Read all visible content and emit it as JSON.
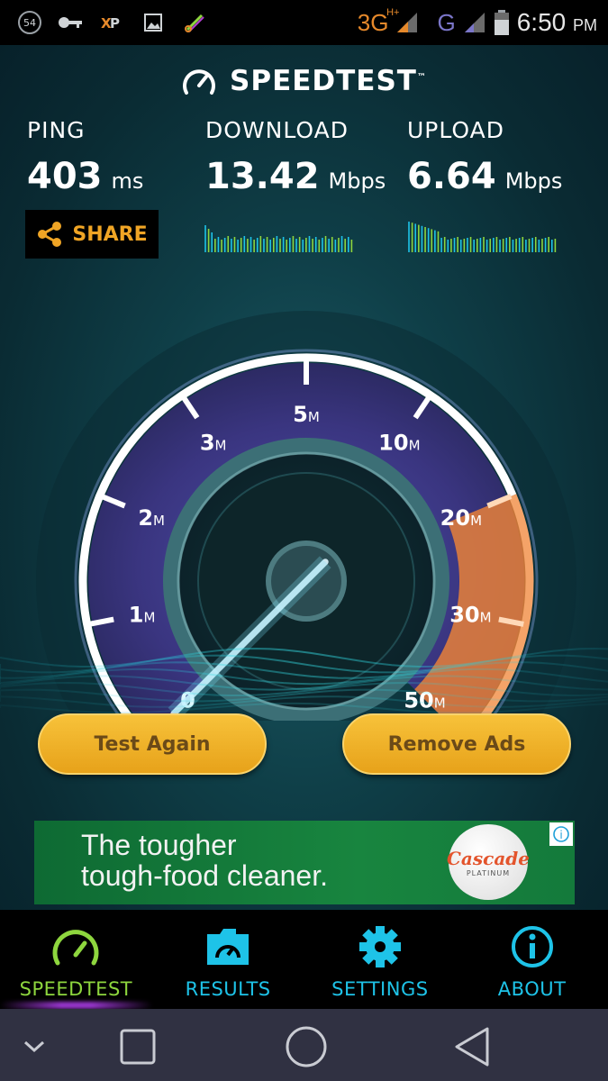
{
  "status_bar": {
    "notification_badge": "54",
    "icons": [
      "key-icon",
      "xp-icon",
      "image-icon",
      "scissors-icon"
    ],
    "network_type": "3G",
    "network_plus": "H+",
    "network_g": "G",
    "time": "6:50",
    "ampm": "PM"
  },
  "app": {
    "brand": "SPEEDTEST",
    "brand_tm": "™"
  },
  "metrics": {
    "ping": {
      "label": "PING",
      "value": "403",
      "unit": "ms"
    },
    "download": {
      "label": "DOWNLOAD",
      "value": "13.42",
      "unit": "Mbps"
    },
    "upload": {
      "label": "UPLOAD",
      "value": "6.64",
      "unit": "Mbps"
    }
  },
  "share": {
    "label": "SHARE"
  },
  "gauge": {
    "ticks": [
      {
        "num": "0",
        "unit": ""
      },
      {
        "num": "1",
        "unit": "M"
      },
      {
        "num": "2",
        "unit": "M"
      },
      {
        "num": "3",
        "unit": "M"
      },
      {
        "num": "5",
        "unit": "M"
      },
      {
        "num": "10",
        "unit": "M"
      },
      {
        "num": "20",
        "unit": "M"
      },
      {
        "num": "30",
        "unit": "M"
      },
      {
        "num": "50",
        "unit": "M"
      }
    ],
    "needle_value": 0,
    "colors": {
      "ring": "#ffffff",
      "highlight": "#e8803a",
      "face": "#3b3a86"
    }
  },
  "actions": {
    "test_again": "Test Again",
    "remove_ads": "Remove Ads"
  },
  "ad": {
    "line1": "The tougher",
    "line2": "tough-food cleaner.",
    "logo": "Cascade",
    "logo_sub": "PLATINUM",
    "info": "i"
  },
  "nav": {
    "items": [
      {
        "label": "SPEEDTEST",
        "icon": "gauge-icon",
        "active": true
      },
      {
        "label": "RESULTS",
        "icon": "results-folder-icon",
        "active": false
      },
      {
        "label": "SETTINGS",
        "icon": "gear-icon",
        "active": false
      },
      {
        "label": "ABOUT",
        "icon": "info-icon",
        "active": false
      }
    ]
  },
  "colors": {
    "accent_green": "#8ed63e",
    "accent_cyan": "#1ec3e8",
    "button_gold": "#f0b22a",
    "share_orange": "#f0a525"
  }
}
